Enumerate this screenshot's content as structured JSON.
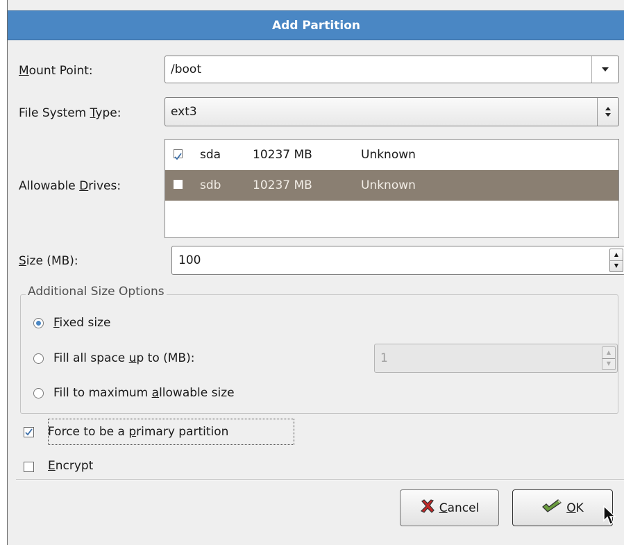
{
  "dialog": {
    "title": "Add Partition"
  },
  "mount_point": {
    "label": "Mount Point:",
    "value": "/boot"
  },
  "fs_type": {
    "label": "File System Type:",
    "value": "ext3"
  },
  "drives": {
    "label": "Allowable Drives:",
    "rows": [
      {
        "checked": true,
        "name": "sda",
        "size": "10237 MB",
        "model": "Unknown",
        "selected": false
      },
      {
        "checked": false,
        "name": "sdb",
        "size": "10237 MB",
        "model": "Unknown",
        "selected": true
      }
    ]
  },
  "size": {
    "label": "Size (MB):",
    "value": "100"
  },
  "size_options": {
    "title": "Additional Size Options",
    "fixed_label": "Fixed size",
    "fill_upto_label": "Fill all space up to (MB):",
    "fill_upto_value": "1",
    "fill_max_label": "Fill to maximum allowable size",
    "selected": "fixed"
  },
  "primary": {
    "label": "Force to be a primary partition",
    "checked": true
  },
  "encrypt": {
    "label": "Encrypt",
    "checked": false
  },
  "buttons": {
    "cancel": "Cancel",
    "ok": "OK"
  },
  "colors": {
    "titlebar": "#4a87c4",
    "selected_row": "#8a7f72",
    "check": "#3b6ea8"
  },
  "icons": {
    "cancel": "red-x-icon",
    "ok": "green-check-icon",
    "cursor": "arrow-cursor-icon"
  }
}
